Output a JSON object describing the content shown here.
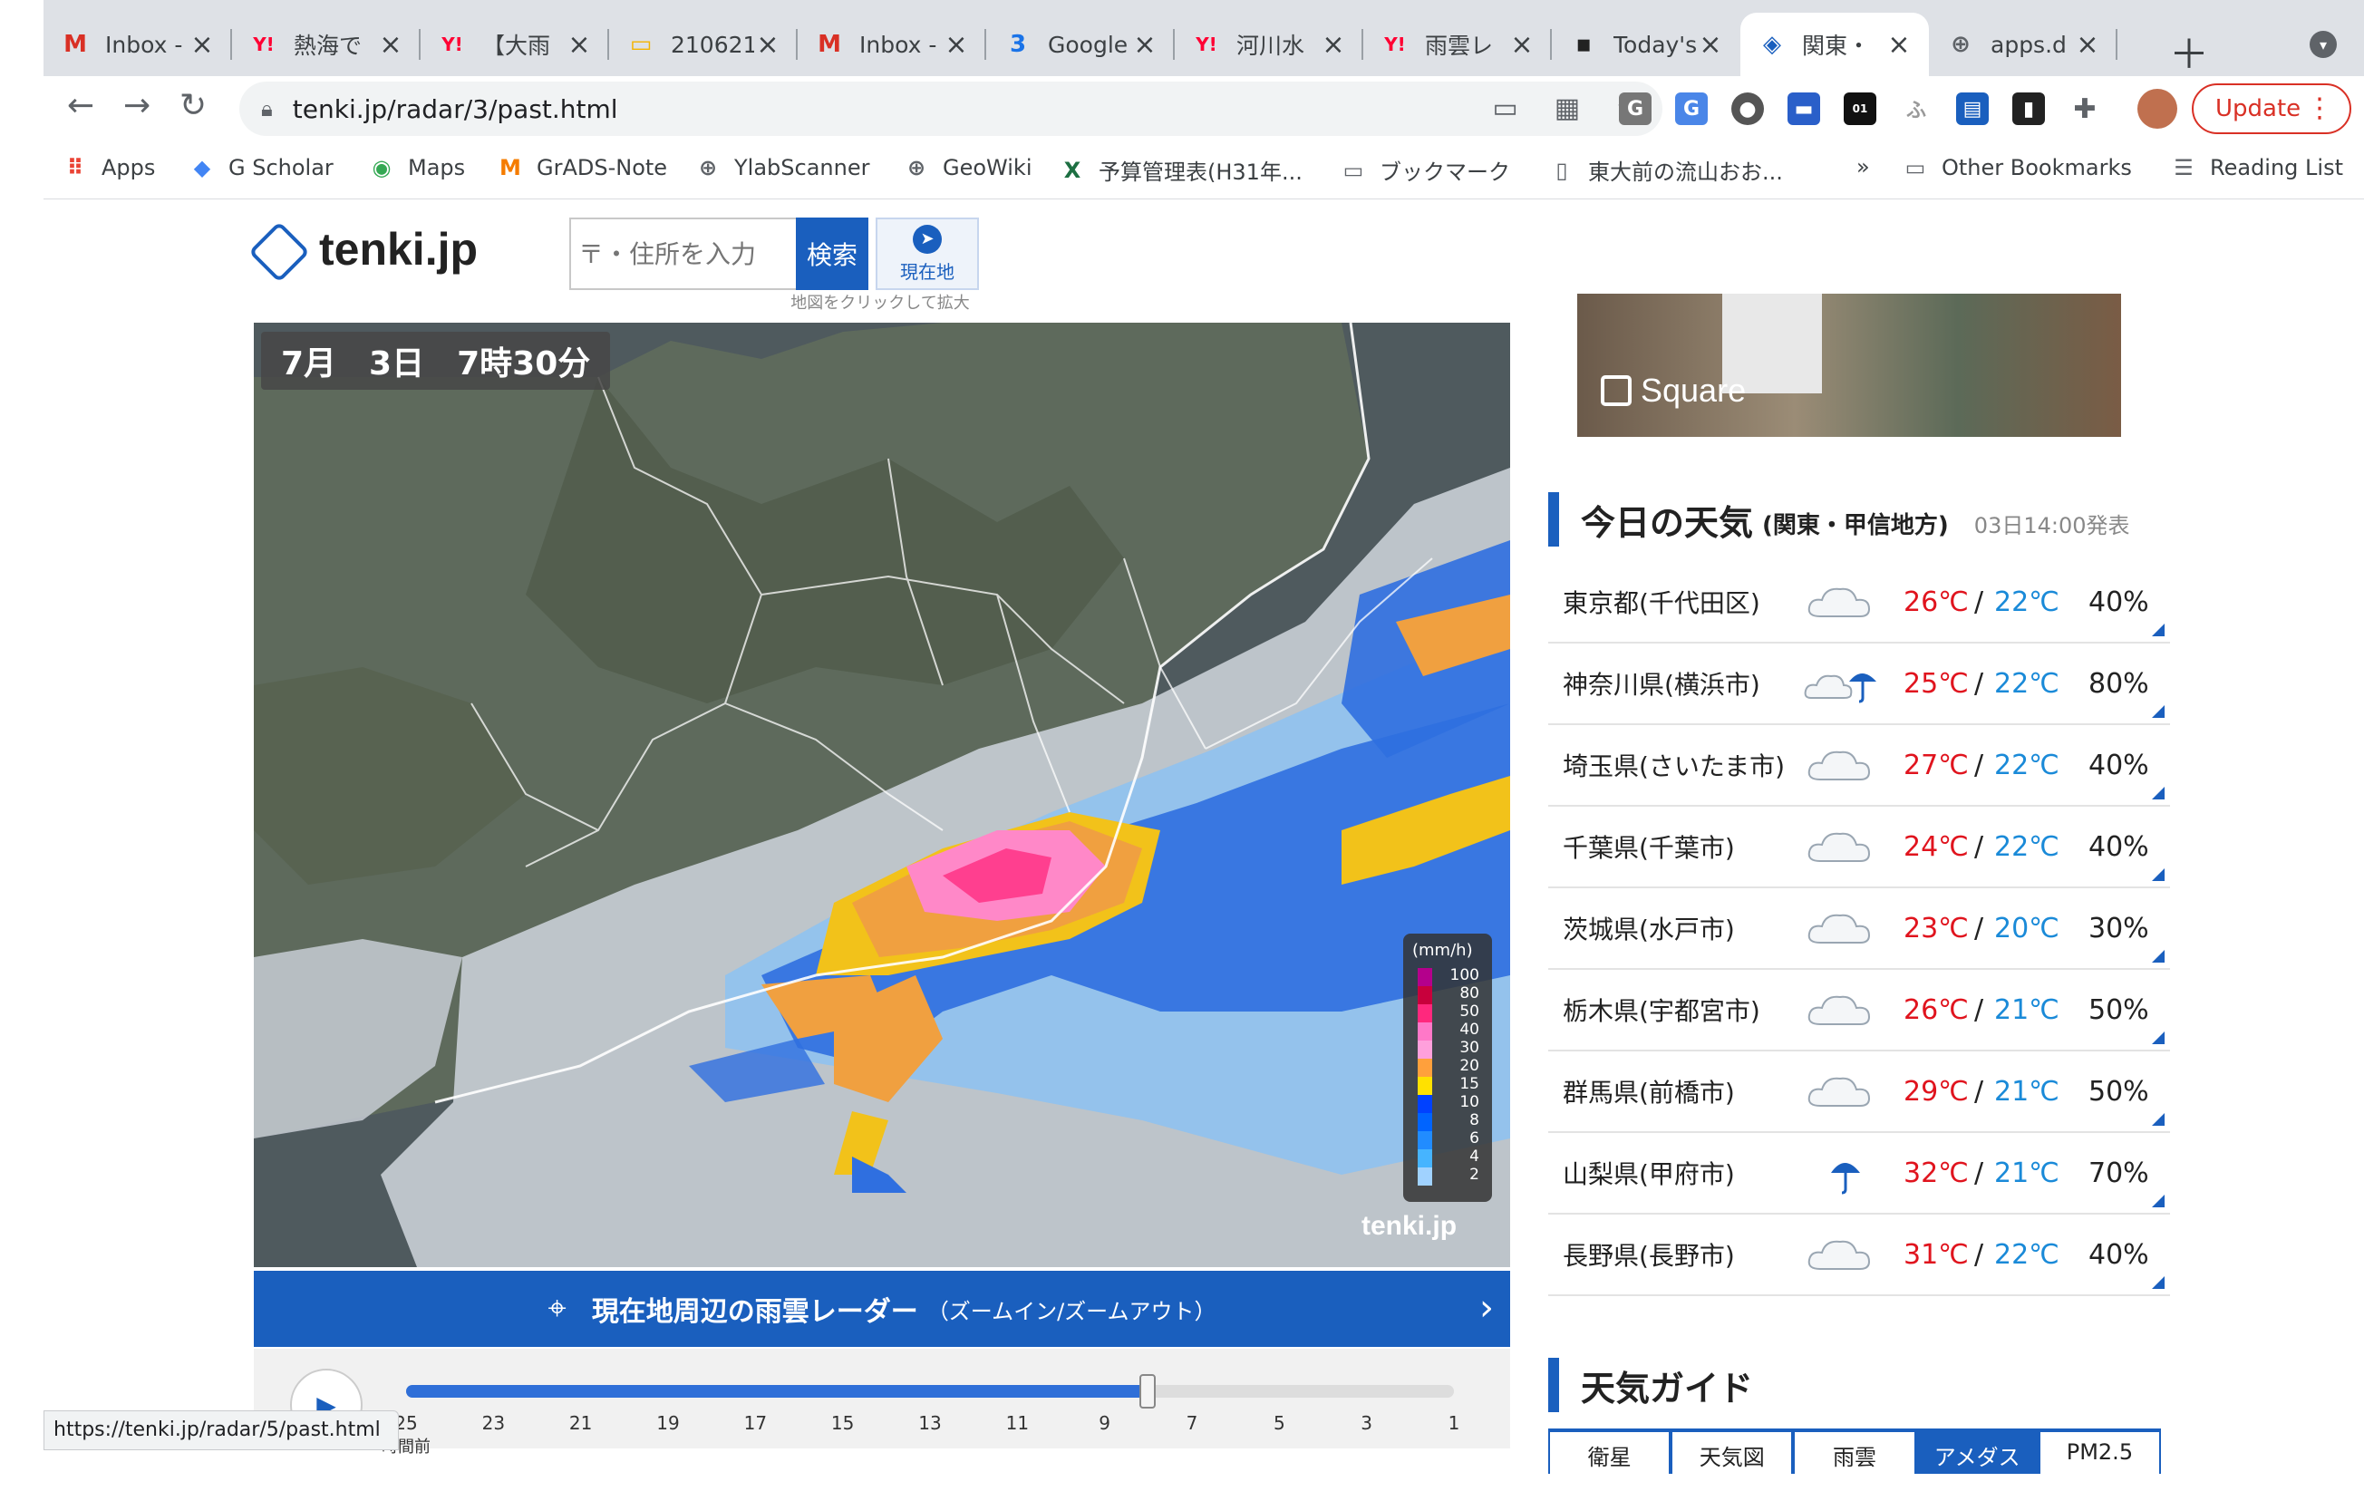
{
  "tabs": [
    {
      "title": "Inbox -",
      "favicon": "gmail-icon",
      "color": "#d93025",
      "glyph": "M"
    },
    {
      "title": "熱海で",
      "favicon": "yahoo-icon",
      "color": "#ff0033",
      "glyph": "Y!"
    },
    {
      "title": "【大雨",
      "favicon": "yahoo-icon",
      "color": "#ff0033",
      "glyph": "Y!"
    },
    {
      "title": "210621",
      "favicon": "slides-icon",
      "color": "#f4b400",
      "glyph": "▭"
    },
    {
      "title": "Inbox -",
      "favicon": "gmail-icon",
      "color": "#d93025",
      "glyph": "M"
    },
    {
      "title": "Google",
      "favicon": "calendar-icon",
      "color": "#1a73e8",
      "glyph": "3"
    },
    {
      "title": "河川水",
      "favicon": "yahoo-icon",
      "color": "#ff0033",
      "glyph": "Y!"
    },
    {
      "title": "雨雲レ",
      "favicon": "yahoo-icon",
      "color": "#ff0033",
      "glyph": "Y!"
    },
    {
      "title": "Today's",
      "favicon": "eorc-icon",
      "color": "#222222",
      "glyph": "▪"
    },
    {
      "title": "関東・",
      "favicon": "tenki-icon",
      "color": "#1a5fbe",
      "glyph": "◈"
    },
    {
      "title": "apps.d",
      "favicon": "globe-icon",
      "color": "#5f6368",
      "glyph": "⊕"
    }
  ],
  "toolbar": {
    "url": "tenki.jp/radar/3/past.html",
    "update_label": "Update"
  },
  "bookmarks": [
    {
      "label": "Apps",
      "icon": "apps-grid-icon",
      "glyph": "⠿",
      "color": "#ea4335"
    },
    {
      "label": "G Scholar",
      "icon": "scholar-icon",
      "glyph": "◆",
      "color": "#4285f4"
    },
    {
      "label": "Maps",
      "icon": "maps-icon",
      "glyph": "◉",
      "color": "#34a853"
    },
    {
      "label": "GrADS-Note",
      "icon": "grads-icon",
      "glyph": "M",
      "color": "#f57c00"
    },
    {
      "label": "YlabScanner",
      "icon": "globe-icon",
      "glyph": "⊕",
      "color": "#5f6368"
    },
    {
      "label": "GeoWiki",
      "icon": "globe-icon",
      "glyph": "⊕",
      "color": "#5f6368"
    },
    {
      "label": "予算管理表(H31年...",
      "icon": "excel-icon",
      "glyph": "X",
      "color": "#1d6f42"
    },
    {
      "label": "ブックマーク",
      "icon": "folder-icon",
      "glyph": "▭",
      "color": "#5f6368"
    },
    {
      "label": "東大前の流山おお...",
      "icon": "page-icon",
      "glyph": "▯",
      "color": "#5f6368"
    },
    {
      "label": "Other Bookmarks",
      "icon": "folder-icon",
      "glyph": "▭",
      "color": "#5f6368"
    },
    {
      "label": "Reading List",
      "icon": "reading-list-icon",
      "glyph": "☰",
      "color": "#5f6368"
    }
  ],
  "bookmarks_more": "»",
  "site": {
    "logo": "tenki.jp",
    "search_placeholder": "〒・住所を入力",
    "search_button": "検索",
    "location_button": "現在地",
    "map_hint": "地図をクリックして拡大",
    "timestamp": "7月　3日　7時30分",
    "legend_unit": "(mm/h)",
    "legend_levels": [
      "100",
      "80",
      "50",
      "40",
      "30",
      "20",
      "15",
      "10",
      "8",
      "6",
      "4",
      "2"
    ],
    "legend_colors": [
      "#b4008c",
      "#c8003c",
      "#ff287d",
      "#ff78c8",
      "#ffa0dc",
      "#ffa03c",
      "#ffe100",
      "#0041ff",
      "#0064ff",
      "#218cff",
      "#46b4ff",
      "#a0d2ff"
    ],
    "map_brand": "tenki.jp",
    "radar_link_main": "現在地周辺の雨雲レーダー",
    "radar_link_sub": "（ズームイン/ズームアウト）",
    "timeline_ticks": [
      "25",
      "23",
      "21",
      "19",
      "17",
      "15",
      "13",
      "11",
      "9",
      "7",
      "5",
      "3",
      "1"
    ],
    "timeline_unit": "時間前",
    "timeline_position": 0.708,
    "status_url": "https://tenki.jp/radar/5/past.html"
  },
  "ad": {
    "brand": "Square"
  },
  "weather": {
    "title": "今日の天気",
    "region": "(関東・甲信地方)",
    "issued": "03日14:00発表",
    "rows": [
      {
        "pref": "東京都(千代田区)",
        "icon": "cloudy-icon",
        "hi": "26℃",
        "lo": "22℃",
        "pop": "40%"
      },
      {
        "pref": "神奈川県(横浜市)",
        "icon": "cloudy-rain-icon",
        "hi": "25℃",
        "lo": "22℃",
        "pop": "80%"
      },
      {
        "pref": "埼玉県(さいたま市)",
        "icon": "cloudy-icon",
        "hi": "27℃",
        "lo": "22℃",
        "pop": "40%"
      },
      {
        "pref": "千葉県(千葉市)",
        "icon": "cloudy-icon",
        "hi": "24℃",
        "lo": "22℃",
        "pop": "40%"
      },
      {
        "pref": "茨城県(水戸市)",
        "icon": "cloudy-icon",
        "hi": "23℃",
        "lo": "20℃",
        "pop": "30%"
      },
      {
        "pref": "栃木県(宇都宮市)",
        "icon": "cloudy-icon",
        "hi": "26℃",
        "lo": "21℃",
        "pop": "50%"
      },
      {
        "pref": "群馬県(前橋市)",
        "icon": "cloudy-icon",
        "hi": "29℃",
        "lo": "21℃",
        "pop": "50%"
      },
      {
        "pref": "山梨県(甲府市)",
        "icon": "umbrella-icon",
        "hi": "32℃",
        "lo": "21℃",
        "pop": "70%"
      },
      {
        "pref": "長野県(長野市)",
        "icon": "cloudy-icon",
        "hi": "31℃",
        "lo": "22℃",
        "pop": "40%"
      }
    ],
    "slash": "/"
  },
  "guide": {
    "title": "天気ガイド",
    "tabs": [
      "衛星",
      "天気図",
      "雨雲",
      "アメダス",
      "PM2.5"
    ],
    "active_tab": 3
  }
}
